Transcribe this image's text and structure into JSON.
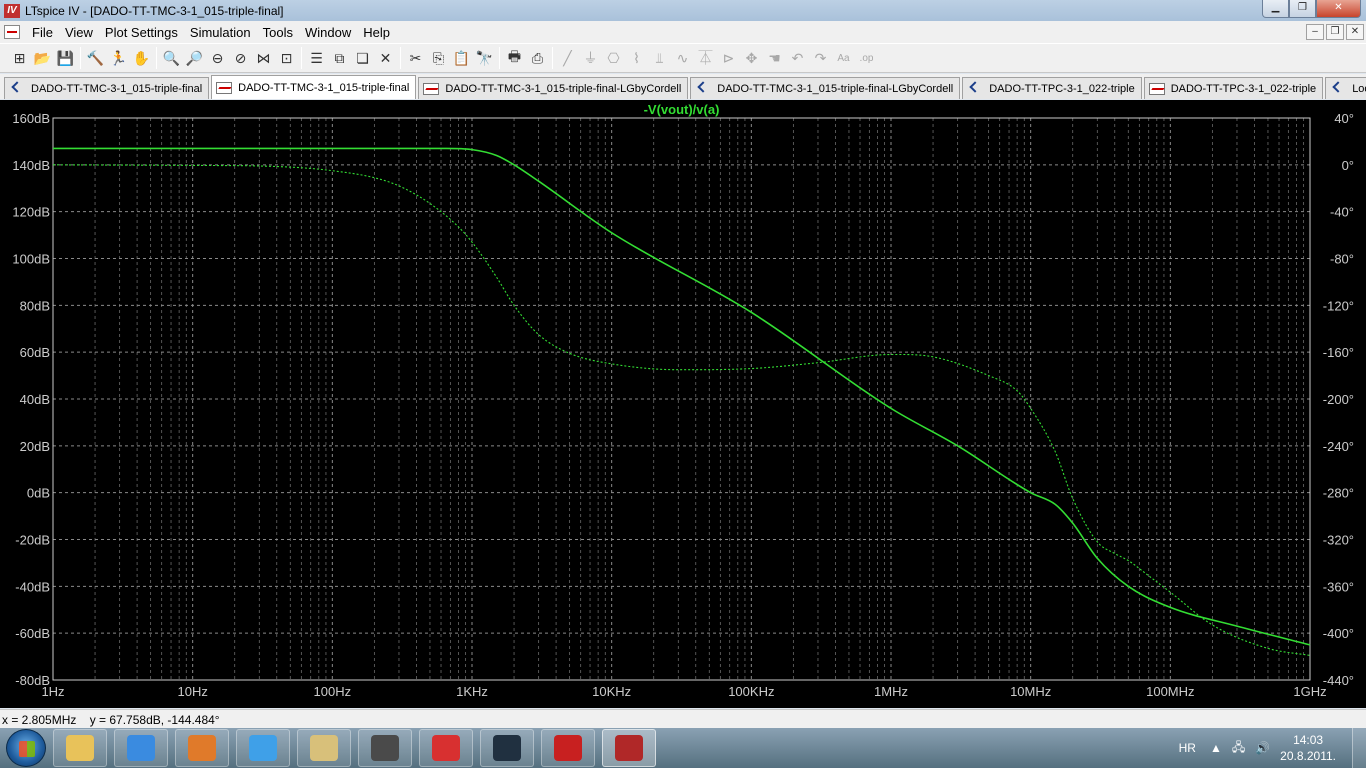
{
  "window": {
    "title": "LTspice IV - [DADO-TT-TMC-3-1_015-triple-final]",
    "app_icon": "ltspice-icon",
    "buttons": [
      "minimize",
      "restore",
      "close"
    ]
  },
  "menu": {
    "items": [
      "File",
      "View",
      "Plot Settings",
      "Simulation",
      "Tools",
      "Window",
      "Help"
    ]
  },
  "toolbar": {
    "buttons": [
      {
        "icon": "new-schematic-icon",
        "glyph": "⊞"
      },
      {
        "icon": "open-icon",
        "glyph": "📂"
      },
      {
        "icon": "save-icon",
        "glyph": "💾"
      },
      {
        "icon": "control-panel-icon",
        "glyph": "🔨"
      },
      {
        "icon": "run-icon",
        "glyph": "🏃"
      },
      {
        "icon": "halt-icon",
        "glyph": "✋"
      },
      {
        "icon": "zoom-in-icon",
        "glyph": "🔍"
      },
      {
        "icon": "zoom-pan-icon",
        "glyph": "🔎"
      },
      {
        "icon": "zoom-out-icon",
        "glyph": "⊖"
      },
      {
        "icon": "zoom-fit-icon",
        "glyph": "⊘"
      },
      {
        "icon": "autorange-icon",
        "glyph": "⋈"
      },
      {
        "icon": "cursor-icon",
        "glyph": "⊡"
      },
      {
        "icon": "tile-horizontal-icon",
        "glyph": "☰"
      },
      {
        "icon": "tile-vertical-icon",
        "glyph": "⧉"
      },
      {
        "icon": "cascade-icon",
        "glyph": "❏"
      },
      {
        "icon": "close-window-icon",
        "glyph": "✕"
      },
      {
        "icon": "cut-icon",
        "glyph": "✂"
      },
      {
        "icon": "copy-icon",
        "glyph": "⎘"
      },
      {
        "icon": "paste-icon",
        "glyph": "📋"
      },
      {
        "icon": "find-icon",
        "glyph": "🔭"
      },
      {
        "icon": "print-setup-icon",
        "glyph": "🖶"
      },
      {
        "icon": "print-icon",
        "glyph": "⎙"
      },
      {
        "icon": "wire-icon",
        "glyph": "╱"
      },
      {
        "icon": "ground-icon",
        "glyph": "⏚"
      },
      {
        "icon": "label-icon",
        "glyph": "⎔"
      },
      {
        "icon": "resistor-icon",
        "glyph": "⌇"
      },
      {
        "icon": "capacitor-icon",
        "glyph": "⫫"
      },
      {
        "icon": "inductor-icon",
        "glyph": "∿"
      },
      {
        "icon": "diode-icon",
        "glyph": "⏄"
      },
      {
        "icon": "component-icon",
        "glyph": "⊳"
      },
      {
        "icon": "move-icon",
        "glyph": "✥"
      },
      {
        "icon": "drag-icon",
        "glyph": "☚"
      },
      {
        "icon": "undo-icon",
        "glyph": "↶"
      },
      {
        "icon": "redo-icon",
        "glyph": "↷"
      },
      {
        "icon": "text-icon",
        "glyph": "Aa"
      },
      {
        "icon": "spice-directive-icon",
        "glyph": ".op"
      }
    ]
  },
  "tabs": [
    {
      "label": "DADO-TT-TMC-3-1_015-triple-final",
      "type": "schematic",
      "active": false
    },
    {
      "label": "DADO-TT-TMC-3-1_015-triple-final",
      "type": "waveform",
      "active": true
    },
    {
      "label": "DADO-TT-TMC-3-1_015-triple-final-LGbyCordell",
      "type": "waveform",
      "active": false
    },
    {
      "label": "DADO-TT-TMC-3-1_015-triple-final-LGbyCordell",
      "type": "schematic",
      "active": false
    },
    {
      "label": "DADO-TT-TPC-3-1_022-triple",
      "type": "schematic",
      "active": false
    },
    {
      "label": "DADO-TT-TPC-3-1_022-triple",
      "type": "waveform",
      "active": false
    },
    {
      "label": "LoopGain",
      "type": "schematic",
      "active": false
    }
  ],
  "chart_data": {
    "type": "line",
    "title": "-V(vout)/v(a)",
    "x_scale": "log",
    "xlim": [
      1,
      1000000000
    ],
    "x_ticks": [
      1,
      10,
      100,
      1000,
      10000,
      100000,
      1000000,
      10000000,
      100000000,
      1000000000
    ],
    "x_tick_labels": [
      "1Hz",
      "10Hz",
      "100Hz",
      "1KHz",
      "10KHz",
      "100KHz",
      "1MHz",
      "10MHz",
      "100MHz",
      "1GHz"
    ],
    "ylim_left": [
      -80,
      160
    ],
    "y_ticks_left": [
      160,
      140,
      120,
      100,
      80,
      60,
      40,
      20,
      0,
      -20,
      -40,
      -60,
      -80
    ],
    "y_tick_labels_left": [
      "160dB",
      "140dB",
      "120dB",
      "100dB",
      "80dB",
      "60dB",
      "40dB",
      "20dB",
      "0dB",
      "-20dB",
      "-40dB",
      "-60dB",
      "-80dB"
    ],
    "ylim_right": [
      -440,
      40
    ],
    "y_ticks_right": [
      40,
      0,
      -40,
      -80,
      -120,
      -160,
      -200,
      -240,
      -280,
      -320,
      -360,
      -400,
      -440
    ],
    "y_tick_labels_right": [
      "40°",
      "0°",
      "-40°",
      "-80°",
      "-120°",
      "-160°",
      "-200°",
      "-240°",
      "-280°",
      "-320°",
      "-360°",
      "-400°",
      "-440°"
    ],
    "grid": true,
    "background": "#000000",
    "trace_color": "#33dd33",
    "axis_color": "#cccccc",
    "series": [
      {
        "name": "-V(vout)/v(a)",
        "kind": "magnitude",
        "axis": "left",
        "style": "solid",
        "x": [
          1,
          10,
          100,
          300,
          600,
          1000,
          1500,
          2000,
          3000,
          10000,
          100000,
          1000000,
          3000000,
          10000000,
          15000000,
          20000000,
          30000000,
          50000000,
          100000000,
          300000000,
          1000000000
        ],
        "y": [
          147,
          147,
          147,
          147,
          147,
          146.5,
          144,
          140,
          133,
          111,
          77,
          36,
          20,
          0,
          -5,
          -13,
          -28,
          -40,
          -49,
          -57,
          -65
        ]
      },
      {
        "kind": "phase",
        "axis": "right",
        "style": "dashed",
        "x": [
          1,
          10,
          30,
          60,
          100,
          200,
          300,
          500,
          800,
          1000,
          1500,
          2000,
          3000,
          5000,
          10000,
          30000,
          100000,
          300000,
          1000000,
          2000000,
          5000000,
          8000000,
          10000000,
          15000000,
          20000000,
          30000000,
          40000000,
          50000000,
          70000000,
          100000000,
          200000000,
          500000000,
          1000000000
        ],
        "y": [
          0,
          -0.5,
          -1,
          -2.5,
          -5,
          -11,
          -18,
          -33,
          -53,
          -66,
          -96,
          -120,
          -145,
          -161,
          -170,
          -175,
          -174,
          -169,
          -162,
          -164,
          -180,
          -193,
          -208,
          -245,
          -285,
          -322,
          -332,
          -338,
          -351,
          -365,
          -393,
          -413,
          -419
        ]
      }
    ]
  },
  "status_bar": {
    "readout": "x = 2.805MHz    y = 67.758dB, -144.484°"
  },
  "taskbar": {
    "start_icon": "windows-start-icon",
    "apps": [
      {
        "icon": "explorer-icon",
        "color": "#e8c25a"
      },
      {
        "icon": "media-player-icon",
        "color": "#3a8be0"
      },
      {
        "icon": "calendar-icon",
        "color": "#e07a2a"
      },
      {
        "icon": "internet-explorer-icon",
        "color": "#3fa0e8"
      },
      {
        "icon": "image-viewer-icon",
        "color": "#d8c07a"
      },
      {
        "icon": "network-tool-icon",
        "color": "#4a4a4a"
      },
      {
        "icon": "antivirus-icon",
        "color": "#d83030"
      },
      {
        "icon": "oscilloscope-icon",
        "color": "#203040"
      },
      {
        "icon": "pdf-reader-icon",
        "color": "#c82020"
      },
      {
        "icon": "ltspice-task-icon",
        "color": "#b02828"
      }
    ],
    "tray": {
      "language": "HR",
      "time": "14:03",
      "date": "20.8.2011."
    }
  }
}
